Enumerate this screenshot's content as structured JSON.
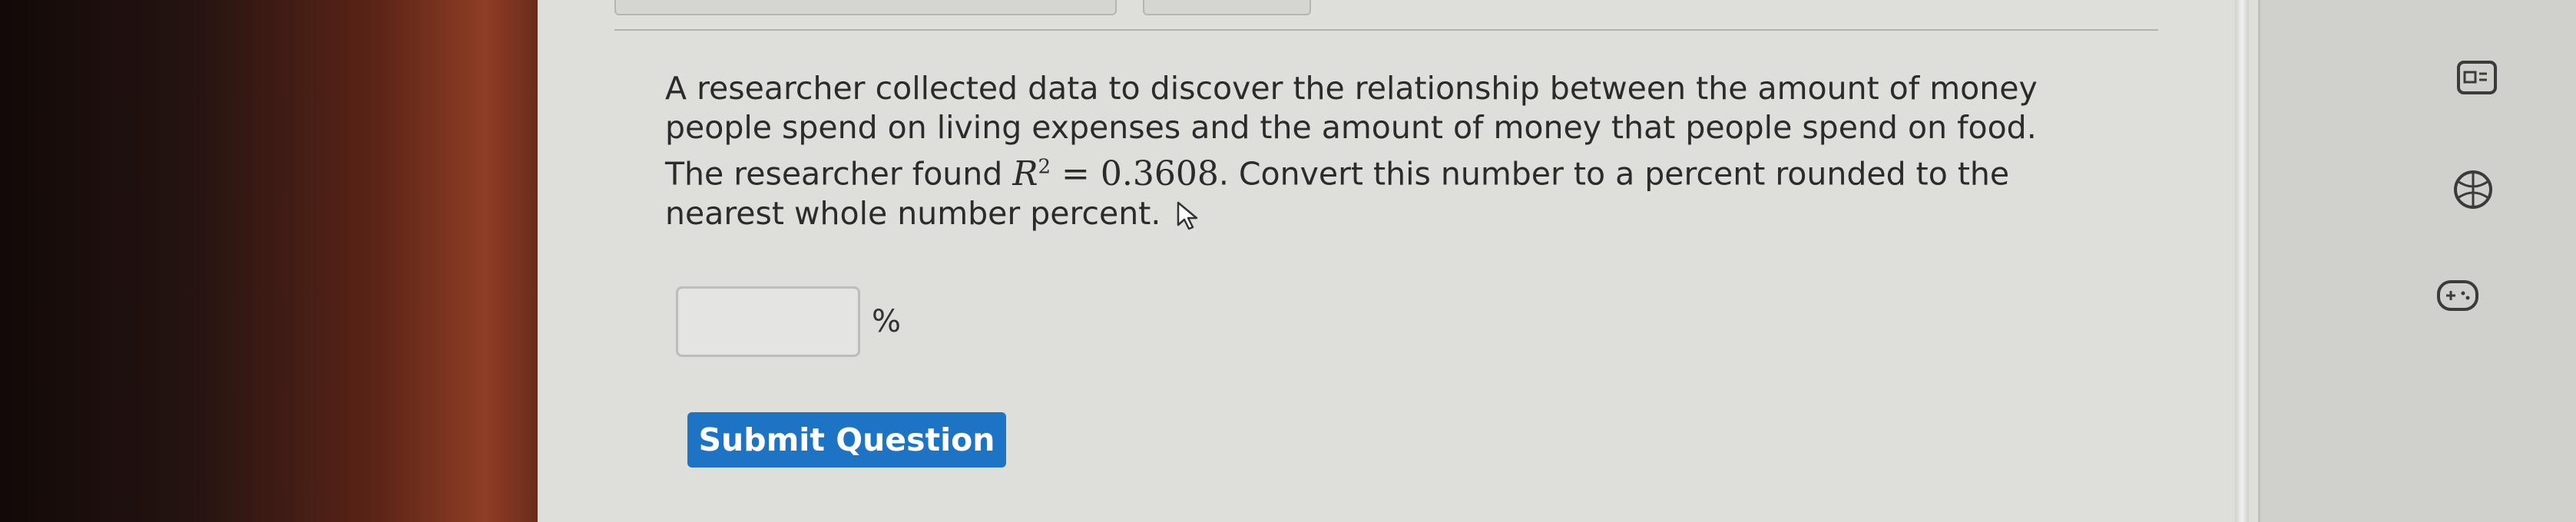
{
  "question": {
    "line1": "A researcher collected data to discover the relationship between the amount of money",
    "line2": "people spend on living expenses and the amount of money that people spend on food.",
    "line3_pre": "The researcher found ",
    "r_symbol": "R",
    "r_exponent": "2",
    "equals_value": " = 0.3608",
    "line3_post": ". Convert this number to a percent rounded to the",
    "line4": "nearest whole number percent."
  },
  "answer": {
    "value": "",
    "placeholder": "",
    "unit": "%"
  },
  "buttons": {
    "submit_label": "Submit Question"
  },
  "sidebar_icons": [
    "calculator-icon",
    "basketball-icon",
    "gamepad-icon"
  ],
  "colors": {
    "submit_bg": "#1d73c4",
    "submit_text": "#ffffff"
  }
}
